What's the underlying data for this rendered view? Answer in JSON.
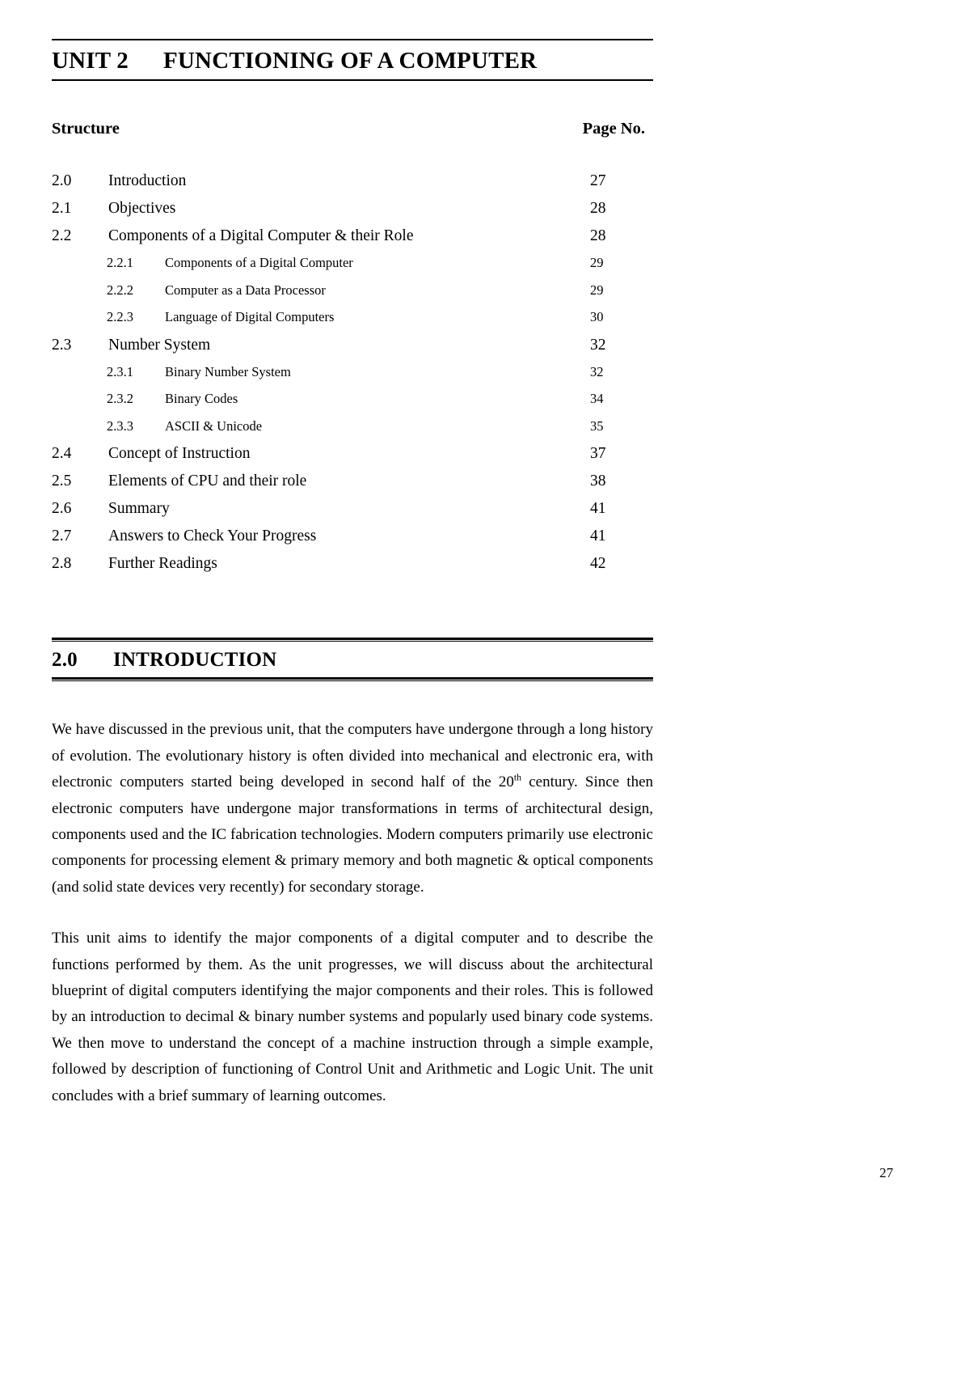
{
  "document": {
    "unit": {
      "number": "UNIT 2",
      "title": "FUNCTIONING OF A COMPUTER"
    },
    "structure_header": {
      "label": "Structure",
      "page_label": "Page No."
    },
    "toc": [
      {
        "level": 1,
        "num": "2.0",
        "title": "Introduction",
        "page": "27"
      },
      {
        "level": 1,
        "num": "2.1",
        "title": "Objectives",
        "page": "28"
      },
      {
        "level": 1,
        "num": "2.2",
        "title": "Components of a Digital Computer & their Role",
        "page": "28"
      },
      {
        "level": 2,
        "num": "2.2.1",
        "title": "Components of a Digital Computer",
        "page": "29"
      },
      {
        "level": 2,
        "num": "2.2.2",
        "title": "Computer as a Data Processor",
        "page": "29"
      },
      {
        "level": 2,
        "num": "2.2.3",
        "title": "Language of Digital Computers",
        "page": "30"
      },
      {
        "level": 1,
        "num": "2.3",
        "title": "Number System",
        "page": "32"
      },
      {
        "level": 2,
        "num": "2.3.1",
        "title": "Binary Number System",
        "page": "32"
      },
      {
        "level": 2,
        "num": "2.3.2",
        "title": "Binary Codes",
        "page": "34"
      },
      {
        "level": 2,
        "num": "2.3.3",
        "title": "ASCII & Unicode",
        "page": "35"
      },
      {
        "level": 1,
        "num": "2.4",
        "title": "Concept of Instruction",
        "page": "37"
      },
      {
        "level": 1,
        "num": "2.5",
        "title": "Elements of CPU and their role",
        "page": "38"
      },
      {
        "level": 1,
        "num": "2.6",
        "title": "Summary",
        "page": "41"
      },
      {
        "level": 1,
        "num": "2.7",
        "title": "Answers to Check Your Progress",
        "page": "41"
      },
      {
        "level": 1,
        "num": "2.8",
        "title": "Further Readings",
        "page": "42"
      }
    ],
    "section": {
      "number": "2.0",
      "title": "INTRODUCTION"
    },
    "paragraphs": {
      "p1_a": "We have discussed in the previous unit, that the computers have undergone through a long history of evolution. The evolutionary history is often divided into mechanical and electronic era, with electronic computers started being developed in second half of the 20",
      "p1_sup": "th",
      "p1_b": " century. Since then electronic computers have undergone major transformations in terms of architectural design, components used and the IC fabrication technologies. Modern computers primarily use electronic components for processing element & primary memory and both magnetic & optical components (and solid state devices very recently) for secondary storage.",
      "p2": "This unit aims to identify the major components of a digital computer and to describe the functions performed by them. As the unit progresses, we will discuss about the architectural blueprint of digital computers identifying the major components and their roles. This is followed by an introduction to decimal & binary number systems and popularly used binary code systems. We then move to understand the concept of a machine instruction through a simple example, followed by description of functioning of Control Unit and Arithmetic and Logic Unit. The unit concludes with a brief summary of learning outcomes."
    },
    "folio": "27"
  }
}
